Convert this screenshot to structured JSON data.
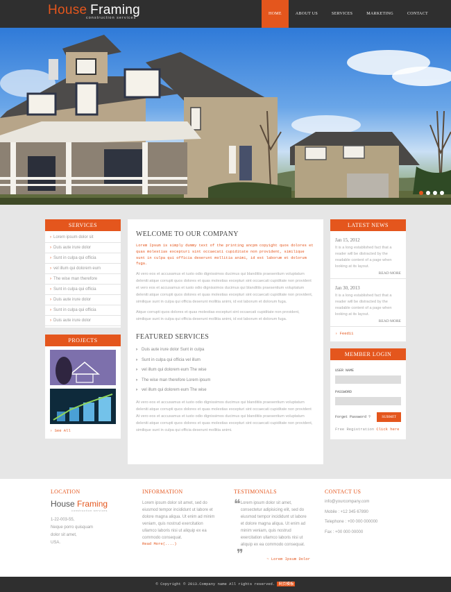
{
  "brand": {
    "title_first": "House",
    "title_second": "Framing",
    "tagline": "construction services"
  },
  "nav": [
    {
      "label": "HOME",
      "active": true
    },
    {
      "label": "ABOUT US"
    },
    {
      "label": "SERVICES"
    },
    {
      "label": "MARKETING"
    },
    {
      "label": "CONTACT"
    }
  ],
  "slider": {
    "dots": 4,
    "active_dot": 1
  },
  "services": {
    "title": "SERVICES",
    "items": [
      "Lorem ipsum dolor sit",
      "Duis aute irure dolor",
      "Sunt in culpa qui officia",
      "vel illum qui dolorem eum",
      "The wise man therefore",
      "Sunt in culpa qui officia",
      "Duis aute irure dolor",
      "Sunt in culpa qui officia",
      "Duis aute irure dolor"
    ]
  },
  "projects": {
    "title": "PROJECTS",
    "see_all": "See All"
  },
  "welcome": {
    "title": "WELCOME TO OUR COMPANY",
    "highlight": "Lorem Ipsum is simply dummy text of the printing ancpm copyight quos dolores et quas molestias excepturi sint occaecati cupiditate non provident, similique sunt in culpa qui officia deserunt mollitia animi, id est laborum et dolorum fuga.",
    "para1": "At vero eos et accusamus et iusto odio dignissimos ducimus qui blanditiis praesentium voluptatum deleniti atque corrupti quos dolores et quas molestias excepturi sint occaecati cupiditate non provident et vero eos et accusamus et iusto odio dignissimos ducimus qui blanditiis praesentium voluptatum deleniti atque corrupti quos dolores et quas molestias excepturi sint occaecati cupiditate non provident, similique sunt in culpa qui officia deserunt mollitia animi, id est laborum et dolorum fuga.",
    "para2": "Atque corrupti quos dolores et quas molestias excepturi sint occaecati cupiditate non provident, similique sunt in culpa qui officia deserunt mollitia animi, id est laborum et dolorum fuga."
  },
  "featured": {
    "title": "FEATURED SERVICES",
    "items": [
      "Duis aute irure dolor Sunt in culpa",
      "Sunt in culpa qui officia vel illum",
      "vel illum qui dolorem eum The wise",
      "The wise man therefore Lorem ipsum",
      "vel illum qui dolorem eum The wise"
    ],
    "para": "At vero eos et accusamus et iusto odio dignissimos ducimus qui blanditiis praesentium voluptatum deleniti atque corrupti quos dolores et quas molestias excepturi sint occaecati cupiditate non provident At vero eos et accusamus et iusto odio dignissimos ducimus qui blanditiis praesentium voluptatum deleniti atque corrupti quos dolores et quas molestias excepturi sint occaecati cupiditate non provident, similique sunt in culpa qui officia deserunt mollitia animi."
  },
  "news": {
    "title": "LATEST NEWS",
    "items": [
      {
        "date": "Jan 15, 2012",
        "text": "It is a long established fact that a reader will be distracted by the readable content of a page when looking at its layout.",
        "more": "READ MORE"
      },
      {
        "date": "Jan 30, 2013",
        "text": "It is a long established fact that a reader will be distracted by the readable content of a page when looking at its layout.",
        "more": "READ MORE"
      }
    ],
    "feed": "Feed11"
  },
  "login": {
    "title": "MEMBER LOGIN",
    "username_label": "USER NAME",
    "password_label": "PASSWORD",
    "forgot": "Forget Password ?",
    "submit": "SUBMIT",
    "register_text": "Free Registration",
    "register_link": "Click here"
  },
  "footer": {
    "location": {
      "title": "LOCATION",
      "logo_first": "House ",
      "logo_second": "Framing",
      "logo_sub": "construction services",
      "lines": [
        "1-22-003-55,",
        "Neque porro quisquam",
        "dolor sit amet,",
        "USA."
      ]
    },
    "information": {
      "title": "INFORMATION",
      "text": "Lorem ipsum dolor sit amet, sed do eiusmod tempor incididunt ut labore et dolore magna aliqua. Ut enim ad minim veniam, quis nostrud exercitation ullamco laboris nisi ut aliquip ex ea commodo consequat.",
      "more": "Read More(....)"
    },
    "testimonials": {
      "title": "TESTIMONIALS",
      "text": "Lorem ipsum dolor sit amet, consectetur adipisicing elit, sed do eiusmod tempor incididunt ut labore et dolore magna aliqua. Ut enim ad minim veniam, quis nostrud exercitation ullamco laboris nisi ut aliquip ex ea commodo consequat.",
      "author": "~ Lorem Ipsum Dolor"
    },
    "contact": {
      "title": "CONTACT US",
      "email": "info@yourcompany.com",
      "mobile": "Mobile : +12 345 67890",
      "telephone": "Telephone : +00 000 000000",
      "fax": "Fax : +00 000 00000"
    }
  },
  "copyright": {
    "text": "© Copyright © 2013.Company name All rights reserved.",
    "link": "网页模板"
  },
  "colors": {
    "accent": "#e4561d",
    "dark": "#2f2f2f"
  }
}
